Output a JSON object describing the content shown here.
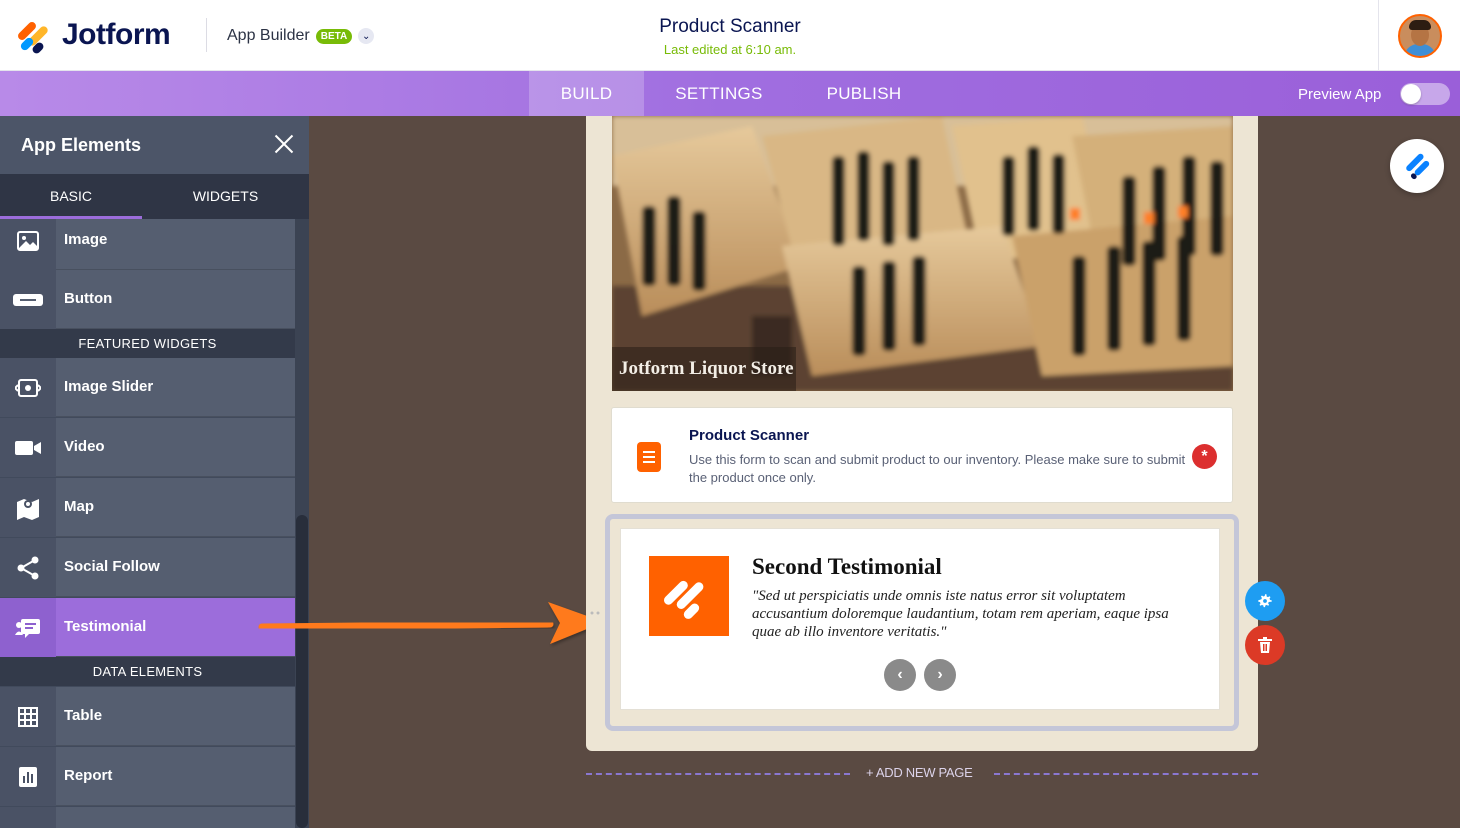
{
  "header": {
    "brand": "Jotform",
    "product": "App Builder",
    "badge": "BETA",
    "title": "Product Scanner",
    "subtitle": "Last edited at 6:10 am."
  },
  "nav": {
    "tabs": [
      {
        "label": "BUILD",
        "active": true
      },
      {
        "label": "SETTINGS",
        "active": false
      },
      {
        "label": "PUBLISH",
        "active": false
      }
    ],
    "preview_label": "Preview App",
    "preview_on": false
  },
  "sidebar": {
    "title": "App Elements",
    "tabs": [
      {
        "label": "BASIC",
        "active": true
      },
      {
        "label": "WIDGETS",
        "active": false
      }
    ],
    "items": [
      {
        "label": "Image",
        "icon": "image-icon"
      },
      {
        "label": "Button",
        "icon": "button-icon"
      },
      {
        "label": "Image Slider",
        "icon": "image-slider-icon"
      },
      {
        "label": "Video",
        "icon": "video-icon"
      },
      {
        "label": "Map",
        "icon": "map-icon"
      },
      {
        "label": "Social Follow",
        "icon": "share-icon"
      },
      {
        "label": "Testimonial",
        "icon": "testimonial-icon",
        "selected": true
      },
      {
        "label": "Table",
        "icon": "table-icon"
      },
      {
        "label": "Report",
        "icon": "report-icon"
      }
    ],
    "sections": {
      "featured": "FEATURED WIDGETS",
      "data": "DATA ELEMENTS"
    }
  },
  "canvas": {
    "hero_caption": "Jotform Liquor Store",
    "form": {
      "title": "Product Scanner",
      "description": "Use this form to scan and submit product to our inventory. Please make sure to submit the product once only.",
      "required_mark": "*"
    },
    "testimonial": {
      "title": "Second Testimonial",
      "quote": "\"Sed ut perspiciatis unde omnis iste natus error sit voluptatem accusantium doloremque laudantium, totam rem aperiam, eaque ipsa quae ab illo inventore veritatis.\"",
      "prev": "‹",
      "next": "›"
    },
    "add_page": "+ ADD NEW PAGE"
  },
  "colors": {
    "brand_orange": "#ff6100",
    "purple": "#9c6ddb",
    "sidebar": "#414a5c",
    "canvas_bg": "#5a4a42",
    "phone_bg": "#ede5d4",
    "gear_blue": "#1e9df2",
    "delete_red": "#dc3a26"
  }
}
